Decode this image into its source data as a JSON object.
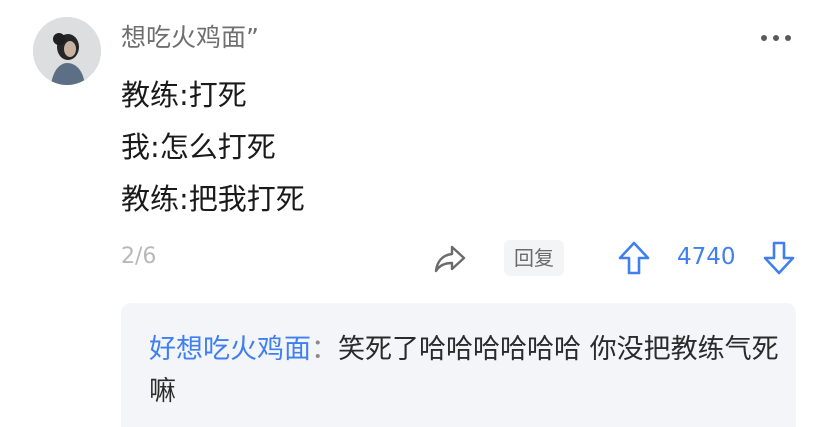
{
  "post": {
    "username": "想吃火鸡面”",
    "lines": [
      "教练:打死",
      "我:怎么打死",
      "教练:把我打死"
    ],
    "page_index": "2/6",
    "reply_label": "回复",
    "vote_count": "4740"
  },
  "reply": {
    "author": "好想吃火鸡面",
    "separator": "：",
    "text": "笑死了哈哈哈哈哈哈 你没把教练气死嘛"
  },
  "icons": {
    "more": "more-dots-icon",
    "share": "share-icon",
    "upvote": "arrow-up-icon",
    "downvote": "arrow-down-icon"
  },
  "colors": {
    "accent": "#3f7ff2",
    "reply_bg": "#f3f5f8",
    "muted": "#b8b8b8"
  }
}
